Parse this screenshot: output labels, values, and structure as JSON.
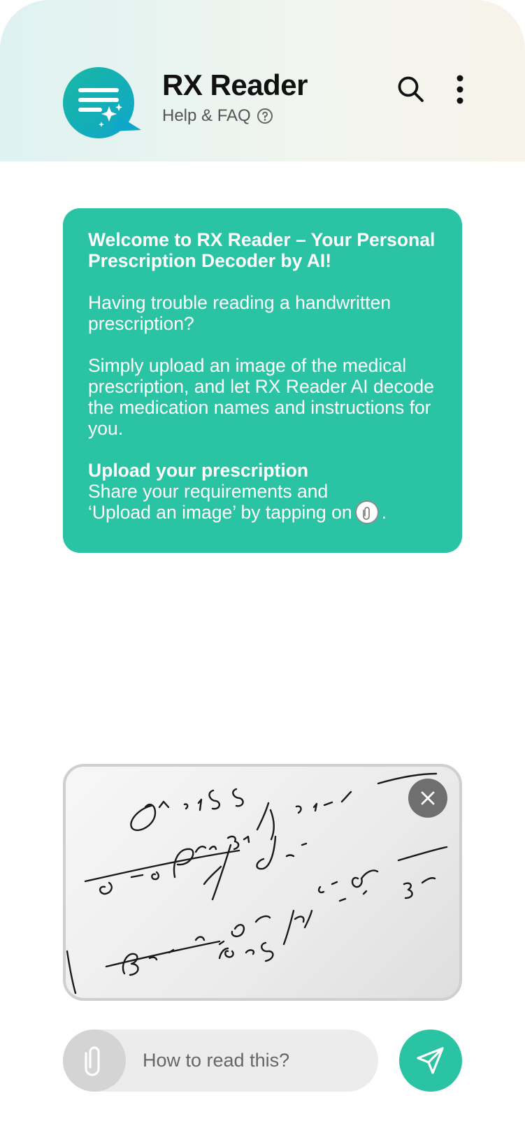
{
  "header": {
    "title": "RX Reader",
    "help_label": "Help & FAQ",
    "icons": [
      "rx-reader-logo-icon",
      "help-circle-icon",
      "search-icon",
      "more-vertical-icon"
    ]
  },
  "welcome": {
    "heading": "Welcome to RX Reader – Your Personal Prescription Decoder by AI!",
    "question": "Having trouble reading a handwritten prescription?",
    "instructions": "Simply upload an image of the medical prescription, and let RX Reader AI decode the medication names and instructions for you.",
    "upload_heading": "Upload your prescription",
    "upload_line1": "Share your requirements and",
    "upload_line2": "‘Upload an image’ by tapping on",
    "upload_line_end": "."
  },
  "composer": {
    "message_value": "",
    "placeholder": "How to read this?",
    "icons": [
      "paperclip-icon",
      "send-icon",
      "close-icon"
    ]
  },
  "colors": {
    "accent": "#2ac3a4",
    "header_gradient_start": "#def2f1",
    "header_gradient_end": "#f6f4ea",
    "input_background": "#ececec",
    "close_button": "#6f6f6f"
  }
}
